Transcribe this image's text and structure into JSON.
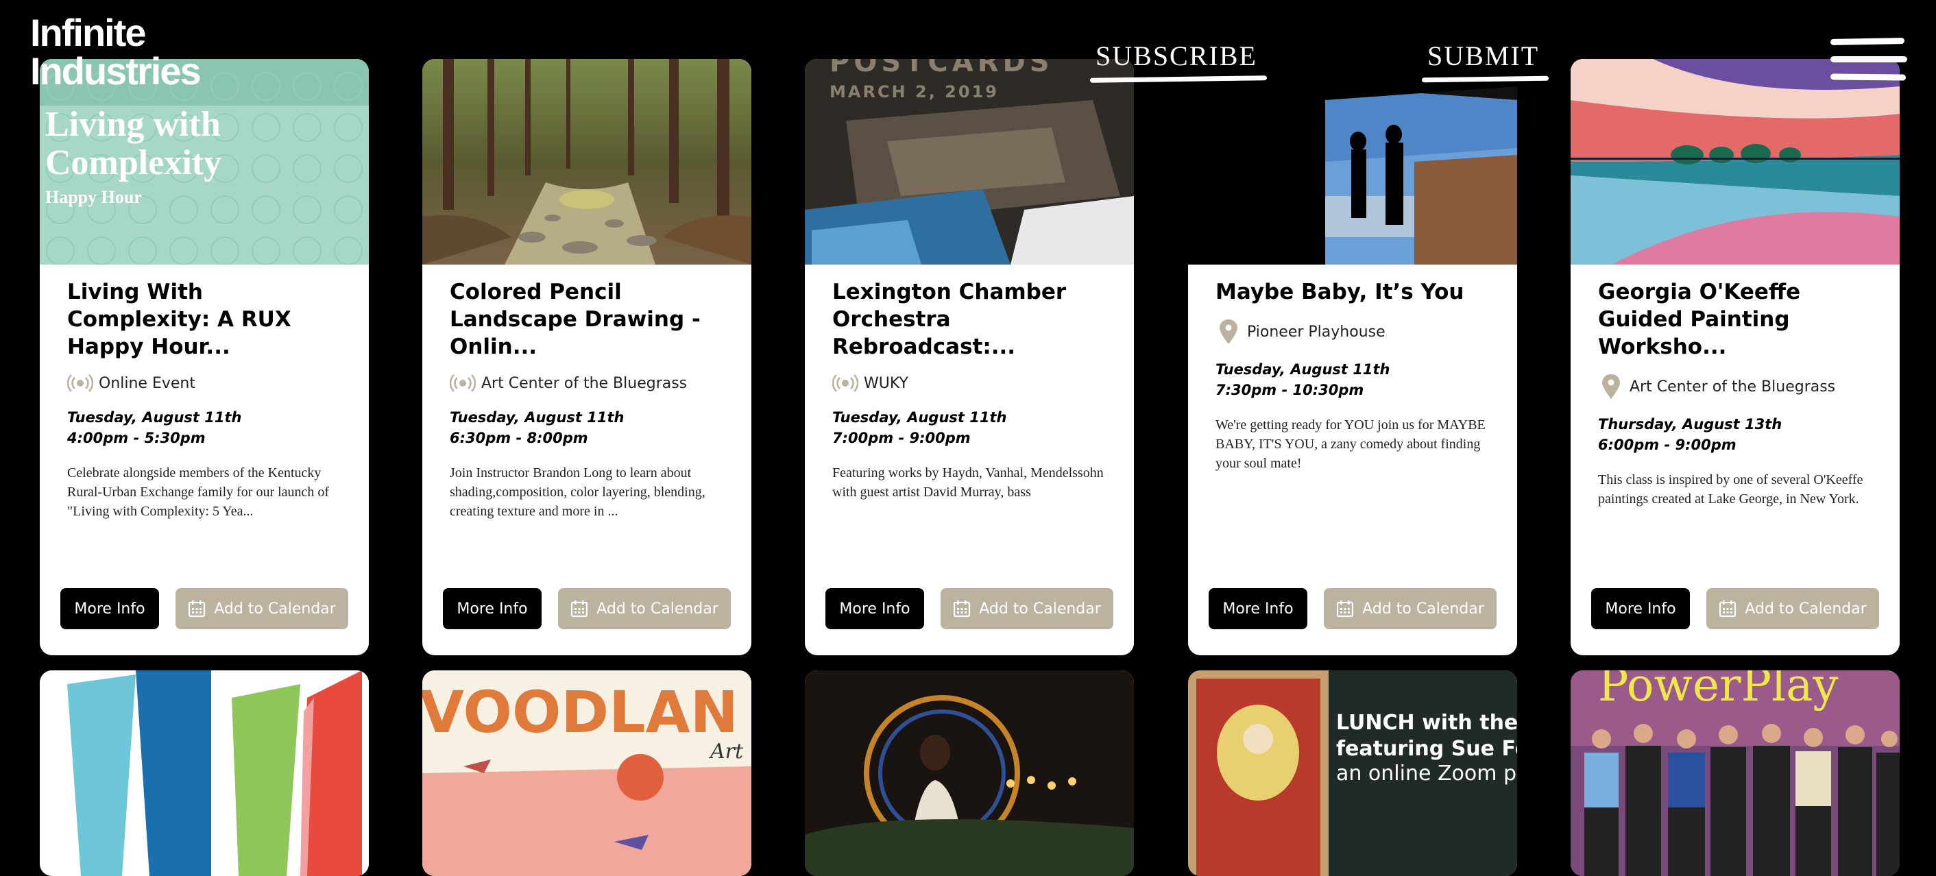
{
  "header": {
    "logo_line1": "Infinite",
    "logo_line2": "Industries",
    "subscribe_label": "SUBSCRIBE",
    "submit_label": "SUBMIT"
  },
  "colors": {
    "background": "#000000",
    "card": "#ffffff",
    "more_info_button": "#000000",
    "calendar_button": "#bbb29f",
    "venue_icon": "#bbb29f"
  },
  "events": [
    {
      "title": "Living With Complexity: A RUX Happy Hour...",
      "venue_icon": "broadcast-icon",
      "venue": "Online Event",
      "date": "Tuesday, August 11th",
      "time": "4:00pm - 5:30pm",
      "description": "Celebrate alongside members of the Kentucky Rural-Urban Exchange family for our launch of \"Living with Complexity: 5 Yea...",
      "image_text_line1": "Living with",
      "image_text_line2": "Complexity",
      "image_text_line3": "Happy Hour",
      "more_info": "More Info",
      "add_to_calendar": "Add to Calendar"
    },
    {
      "title": "Colored Pencil Landscape Drawing - Onlin...",
      "venue_icon": "broadcast-icon",
      "venue": "Art Center of the Bluegrass",
      "date": "Tuesday, August 11th",
      "time": "6:30pm - 8:00pm",
      "description": "Join Instructor Brandon Long to learn about shading,composition, color layering, blending, creating texture and more in ...",
      "more_info": "More Info",
      "add_to_calendar": "Add to Calendar"
    },
    {
      "title": "Lexington Chamber Orchestra Rebroadcast:...",
      "venue_icon": "broadcast-icon",
      "venue": "WUKY",
      "date": "Tuesday, August 11th",
      "time": "7:00pm - 9:00pm",
      "description": "Featuring works by Haydn, Vanhal, Mendelssohn with guest artist David Murray, bass",
      "image_text_line1": "POSTCARDS",
      "image_text_line2": "MARCH 2, 2019",
      "more_info": "More Info",
      "add_to_calendar": "Add to Calendar"
    },
    {
      "title": "Maybe Baby, It’s You",
      "venue_icon": "map-pin-icon",
      "venue": "Pioneer Playhouse",
      "date": "Tuesday, August 11th",
      "time": "7:30pm - 10:30pm",
      "description": "We're getting ready for YOU join us for MAYBE BABY, IT'S YOU, a zany comedy about finding your soul mate!",
      "more_info": "More Info",
      "add_to_calendar": "Add to Calendar"
    },
    {
      "title": "Georgia O'Keeffe Guided Painting Worksho...",
      "venue_icon": "map-pin-icon",
      "venue": "Art Center of the Bluegrass",
      "date": "Thursday, August 13th",
      "time": "6:00pm - 9:00pm",
      "description": "This class is inspired by one of several O'Keeffe paintings created at Lake George, in New York.",
      "more_info": "More Info",
      "add_to_calendar": "Add to Calendar"
    }
  ],
  "row2_images": [
    {
      "text": ""
    },
    {
      "text_main": "VOODLAN",
      "text_script": "Art"
    },
    {
      "text": ""
    },
    {
      "line1": "LUNCH with the A",
      "line2": "featuring Sue Fergu",
      "line3": "an online Zoom prog"
    },
    {
      "text": "PowerPlay"
    }
  ]
}
